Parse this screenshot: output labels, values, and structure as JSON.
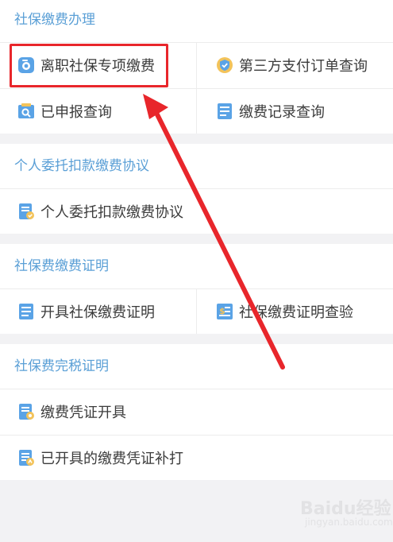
{
  "sections": [
    {
      "title": "社保缴费办理",
      "items": [
        {
          "label": "离职社保专项缴费",
          "icon": "folder-shield-icon"
        },
        {
          "label": "第三方支付订单查询",
          "icon": "shield-badge-icon"
        },
        {
          "label": "已申报查询",
          "icon": "search-document-icon"
        },
        {
          "label": "缴费记录查询",
          "icon": "record-list-icon"
        }
      ]
    },
    {
      "title": "个人委托扣款缴费协议",
      "items": [
        {
          "label": "个人委托扣款缴费协议",
          "icon": "agreement-document-icon"
        }
      ]
    },
    {
      "title": "社保费缴费证明",
      "items": [
        {
          "label": "开具社保缴费证明",
          "icon": "certificate-document-icon"
        },
        {
          "label": "社保缴费证明查验",
          "icon": "verify-calculator-icon"
        }
      ]
    },
    {
      "title": "社保费完税证明",
      "items": [
        {
          "label": "缴费凭证开具",
          "icon": "voucher-document-icon"
        },
        {
          "label": "已开具的缴费凭证补打",
          "icon": "reprint-document-icon"
        }
      ]
    }
  ],
  "watermark": {
    "text": "Baidu经验",
    "sub": "jingyan.baidu.com"
  },
  "colors": {
    "accent": "#5a9fd6",
    "highlight": "#e8262b",
    "background": "#f2f2f4"
  }
}
